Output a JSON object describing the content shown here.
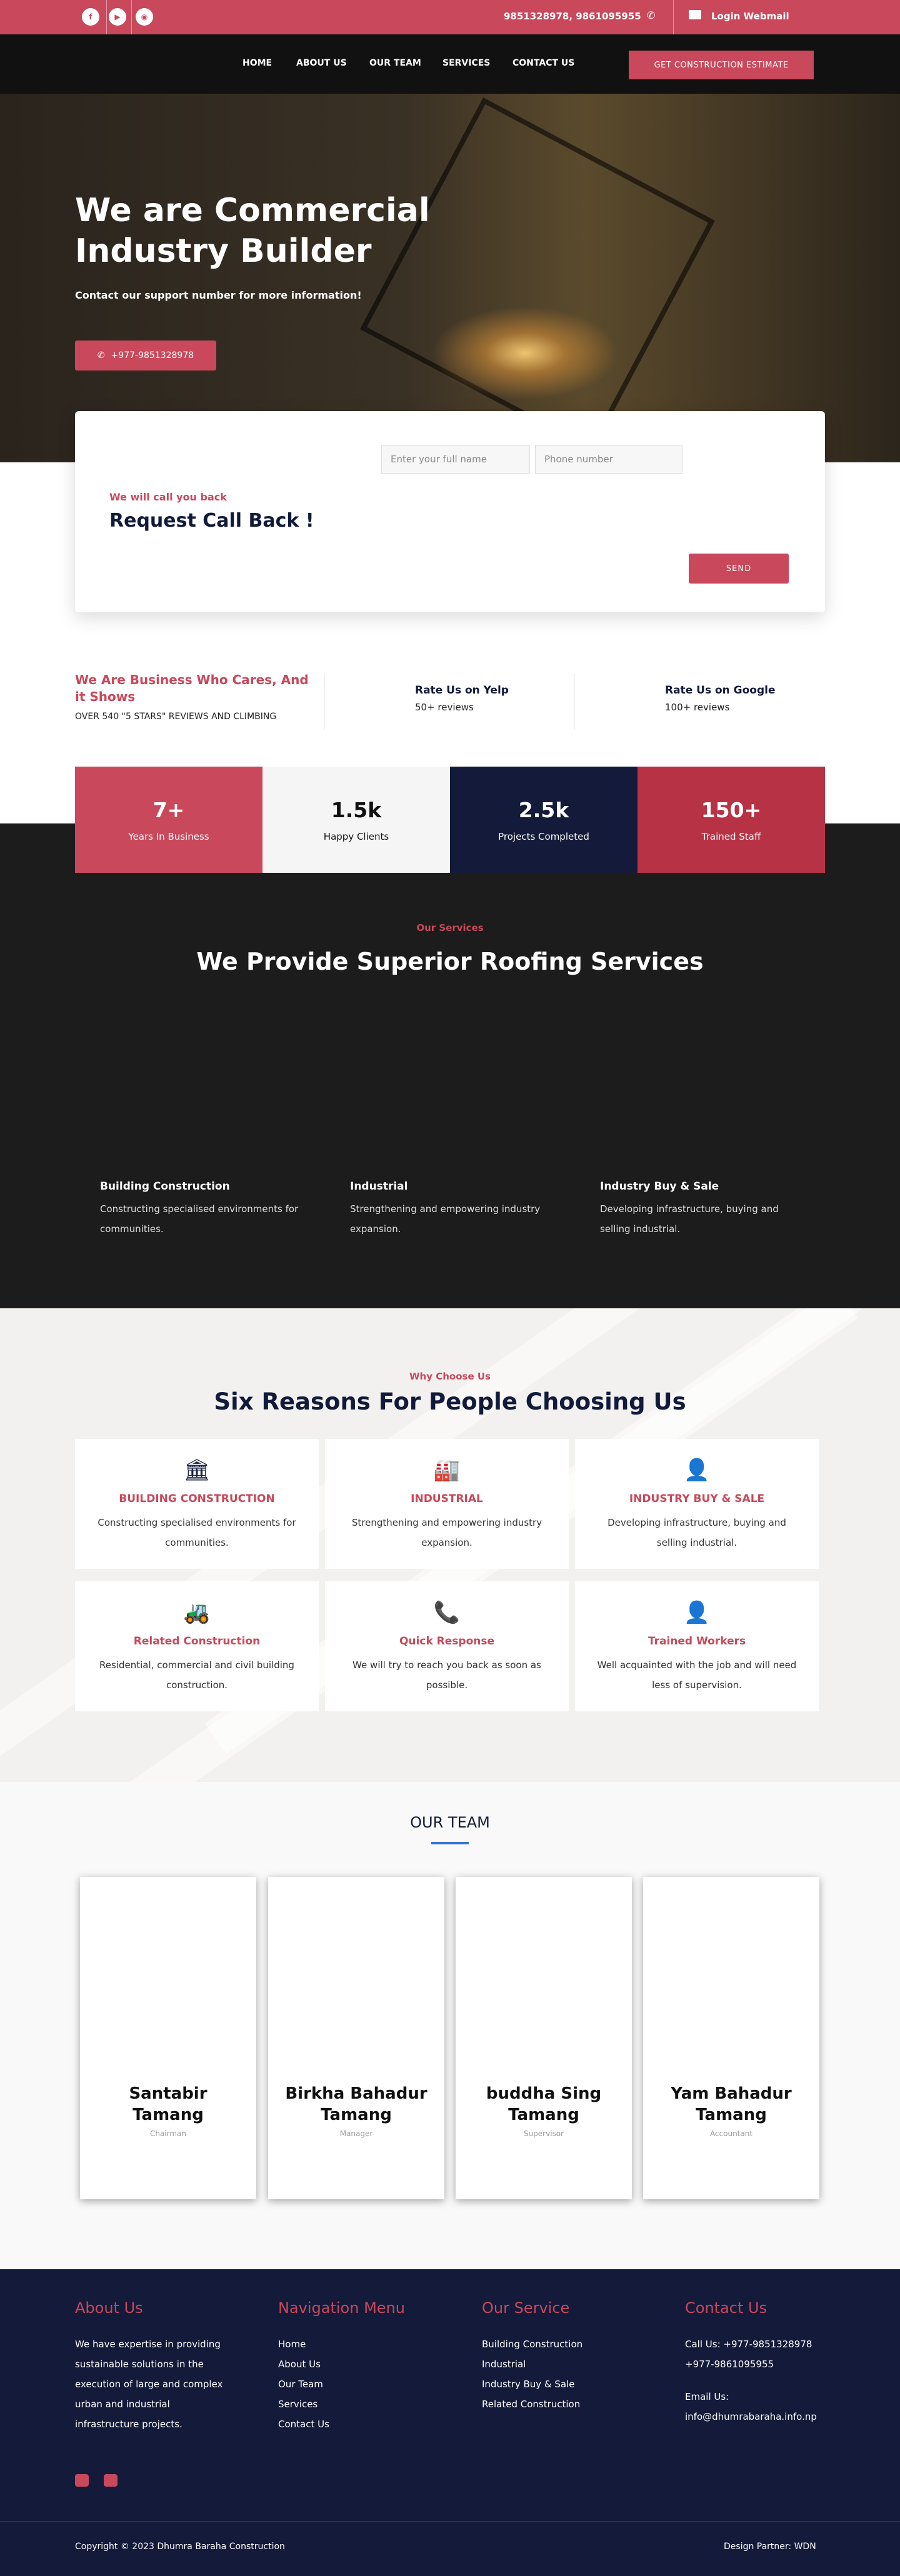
{
  "topbar": {
    "phones": "9851328978, 9861095955",
    "webmail": "Login Webmail"
  },
  "nav": [
    "HOME",
    "ABOUT US",
    "OUR TEAM",
    "SERVICES",
    "CONTACT US"
  ],
  "estimate": "GET CONSTRUCTION ESTIMATE",
  "hero": {
    "title": "We are Commercial Industry Builder",
    "subtitle": "Contact our support number for more information!",
    "phone": "+977-9851328978"
  },
  "callback": {
    "name_placeholder": "Enter your full name",
    "phone_placeholder": "Phone number",
    "small": "We will call you back",
    "title": "Request Call Back !",
    "send": "SEND"
  },
  "reviews": {
    "title": "We Are Business Who Cares, And it Shows",
    "sub": "OVER 540 \"5 STARS\" REVIEWS AND CLIMBING",
    "yelp": "Rate Us on Yelp",
    "yelp_sub": "50+ reviews",
    "google": "Rate Us on Google",
    "google_sub": "100+ reviews"
  },
  "stats": [
    {
      "n": "7+",
      "l": "Years In Business",
      "bg": "#c9485b",
      "fg": "#fff"
    },
    {
      "n": "1.5k",
      "l": "Happy Clients",
      "bg": "#f5f5f5",
      "fg": "#111"
    },
    {
      "n": "2.5k",
      "l": "Projects Completed",
      "bg": "#131a3a",
      "fg": "#fff"
    },
    {
      "n": "150+",
      "l": "Trained Staff",
      "bg": "#b73245",
      "fg": "#fff"
    }
  ],
  "services": {
    "small": "Our Services",
    "title": "We Provide Superior Roofing Services",
    "items": [
      {
        "t": "Building Construction",
        "d": "Constructing specialised environments for communities."
      },
      {
        "t": "Industrial",
        "d": "Strengthening and empowering industry expansion."
      },
      {
        "t": "Industry Buy & Sale",
        "d": "Developing infrastructure, buying and selling industrial."
      }
    ]
  },
  "why": {
    "small": "Why Choose Us",
    "title": "Six Reasons For People Choosing Us",
    "items": [
      {
        "icon": "building-icon",
        "g": "🏛",
        "t": "BUILDING CONSTRUCTION",
        "d": "Constructing specialised environments for communities."
      },
      {
        "icon": "factory-icon",
        "g": "🏭",
        "t": "INDUSTRIAL",
        "d": "Strengthening and empowering industry expansion."
      },
      {
        "icon": "user-icon",
        "g": "👤",
        "t": "INDUSTRY BUY & SALE",
        "d": "Developing infrastructure, buying and selling industrial."
      },
      {
        "icon": "excavator-icon",
        "g": "🚜",
        "t": "Related Construction",
        "d": "Residential, commercial and civil building construction."
      },
      {
        "icon": "phone-icon",
        "g": "📞",
        "t": "Quick Response",
        "d": "We will try to reach you back as soon as possible."
      },
      {
        "icon": "user-icon",
        "g": "👤",
        "t": "Trained Workers",
        "d": "Well acquainted with the job and will need less of supervision."
      }
    ]
  },
  "team": {
    "title": "OUR TEAM",
    "members": [
      {
        "n": "Santabir Tamang",
        "r": "Chairman"
      },
      {
        "n": "Birkha Bahadur Tamang",
        "r": "Manager"
      },
      {
        "n": "buddha Sing Tamang",
        "r": "Supervisor"
      },
      {
        "n": "Yam Bahadur Tamang",
        "r": "Accountant"
      }
    ]
  },
  "footer": {
    "about_h": "About Us",
    "about": "We have expertise in providing sustainable solutions in the execution of large and complex urban and industrial infrastructure projects.",
    "nav_h": "Navigation Menu",
    "nav": [
      "Home",
      "About Us",
      "Our Team",
      "Services",
      "Contact Us"
    ],
    "svc_h": "Our Service",
    "svc": [
      "Building Construction",
      "Industrial",
      "Industry Buy & Sale",
      "Related Construction"
    ],
    "contact_h": "Contact Us",
    "call1": "Call Us: +977-9851328978",
    "call2": "+977-9861095955",
    "email_h": "Email Us:",
    "email": "info@dhumrabaraha.info.np",
    "copy": "Copyright © 2023 Dhumra Baraha Construction",
    "partner": "Design Partner: WDN"
  }
}
